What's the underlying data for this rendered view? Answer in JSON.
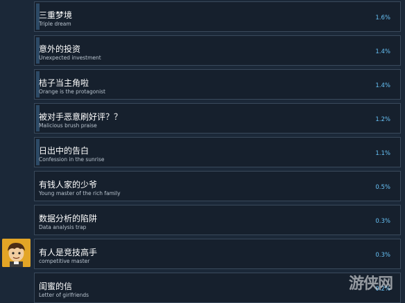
{
  "achievements": [
    {
      "title": "三重梦境",
      "subtitle": "Triple dream",
      "percent": "1.6%",
      "progress": 0.016
    },
    {
      "title": "意外的投资",
      "subtitle": "Unexpected investment",
      "percent": "1.4%",
      "progress": 0.014
    },
    {
      "title": "桔子当主角啦",
      "subtitle": "Orange is the protagonist",
      "percent": "1.4%",
      "progress": 0.014
    },
    {
      "title": "被对手恶意刷好评？？",
      "subtitle": "Malicious brush praise",
      "percent": "1.2%",
      "progress": 0.012
    },
    {
      "title": "日出中的告白",
      "subtitle": "Confession in the sunrise",
      "percent": "1.1%",
      "progress": 0.011
    },
    {
      "title": "有钱人家的少爷",
      "subtitle": "Young master of the rich family",
      "percent": "0.5%",
      "progress": 0.005
    },
    {
      "title": "数据分析的陷阱",
      "subtitle": "Data analysis trap",
      "percent": "0.3%",
      "progress": 0.003
    },
    {
      "title": "有人是竞技高手",
      "subtitle": "competitive master",
      "percent": "0.3%",
      "progress": 0.003
    },
    {
      "title": "闺蜜的信",
      "subtitle": "Letter of girlfriends",
      "percent": "0.2%",
      "progress": 0.002
    }
  ],
  "watermark": "游侠网",
  "colors": {
    "background": "#1b2838",
    "row": "#16202d",
    "border": "#3a4a5c",
    "percent": "#67c1f5",
    "progress_bar": "#2d4a66",
    "avatar_bg": "#e3a526"
  },
  "avatar_icon": "cartoon-boy-avatar"
}
